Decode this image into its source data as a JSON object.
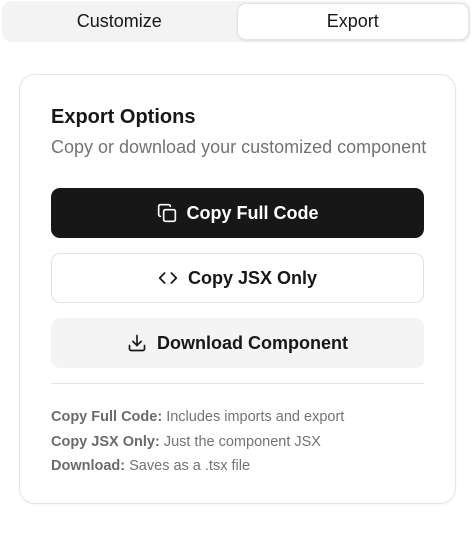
{
  "tabs": [
    {
      "label": "Customize",
      "active": false
    },
    {
      "label": "Export",
      "active": true
    }
  ],
  "card": {
    "title": "Export Options",
    "description": "Copy or download your customized component"
  },
  "buttons": {
    "copy_full": {
      "label": "Copy Full Code",
      "icon": "copy-icon"
    },
    "copy_jsx": {
      "label": "Copy JSX Only",
      "icon": "code-icon"
    },
    "download": {
      "label": "Download Component",
      "icon": "download-icon"
    }
  },
  "notes": [
    {
      "term": "Copy Full Code:",
      "text": "Includes imports and export"
    },
    {
      "term": "Copy JSX Only:",
      "text": "Just the component JSX"
    },
    {
      "term": "Download:",
      "text": "Saves as a .tsx file"
    }
  ],
  "colors": {
    "primary": "#171717",
    "muted_text": "#737373",
    "border": "#e4e4e4",
    "secondary_bg": "#f4f4f4"
  }
}
